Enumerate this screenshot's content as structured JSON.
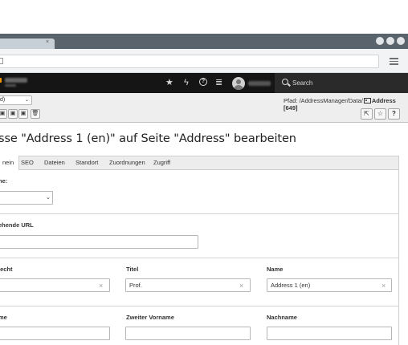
{
  "browser": {
    "tab_close": "×",
    "button_colors": [
      "#e1e5e8",
      "#e1e5e8",
      "#e1e5e8"
    ]
  },
  "topbar": {
    "icons": [
      "star-icon",
      "bolt-icon",
      "help-icon",
      "list-icon"
    ],
    "icon_glyphs": [
      "★",
      "ϟ",
      "?",
      "≣"
    ],
    "search_label": "Search",
    "accent": "#f49700"
  },
  "docheader": {
    "language_value": "d)",
    "language_chevron": "⌄",
    "path_prefix": "Pfad: /AddressManager/Data/",
    "record_title": "Address [649]",
    "left_buttons": [
      "save-icon",
      "save-close-icon",
      "save-new-icon",
      "delete-icon"
    ],
    "left_glyphs": [
      "▣",
      "▣",
      "▣",
      "🗑"
    ],
    "right_buttons": [
      "open-new-window-icon",
      "bookmark-icon",
      "help-icon"
    ],
    "right_glyphs": [
      "⇱",
      "☆",
      "?"
    ]
  },
  "page": {
    "heading": "sse \"Address 1 (en)\" auf Seite \"Address\" bearbeiten"
  },
  "tabs": [
    {
      "label": "nein",
      "active": true
    },
    {
      "label": "SEO",
      "active": false
    },
    {
      "label": "Dateien",
      "active": false
    },
    {
      "label": "Standort",
      "active": false
    },
    {
      "label": "Zuordnungen",
      "active": false
    },
    {
      "label": "Zugriff",
      "active": false
    }
  ],
  "form": {
    "type_label": "he:",
    "type_value": "",
    "url_label": "ehende URL",
    "url_value": "",
    "gender_label": "lecht",
    "gender_value": "",
    "title_label": "Titel",
    "title_value": "Prof.",
    "name_label": "Name",
    "name_value": "Address 1 (en)",
    "firstname_label": "me",
    "firstname_value": "",
    "middlename_label": "Zweiter Vorname",
    "middlename_value": "",
    "lastname_label": "Nachname",
    "lastname_value": "",
    "clear_glyph": "×",
    "select_chevron": "⌄"
  }
}
